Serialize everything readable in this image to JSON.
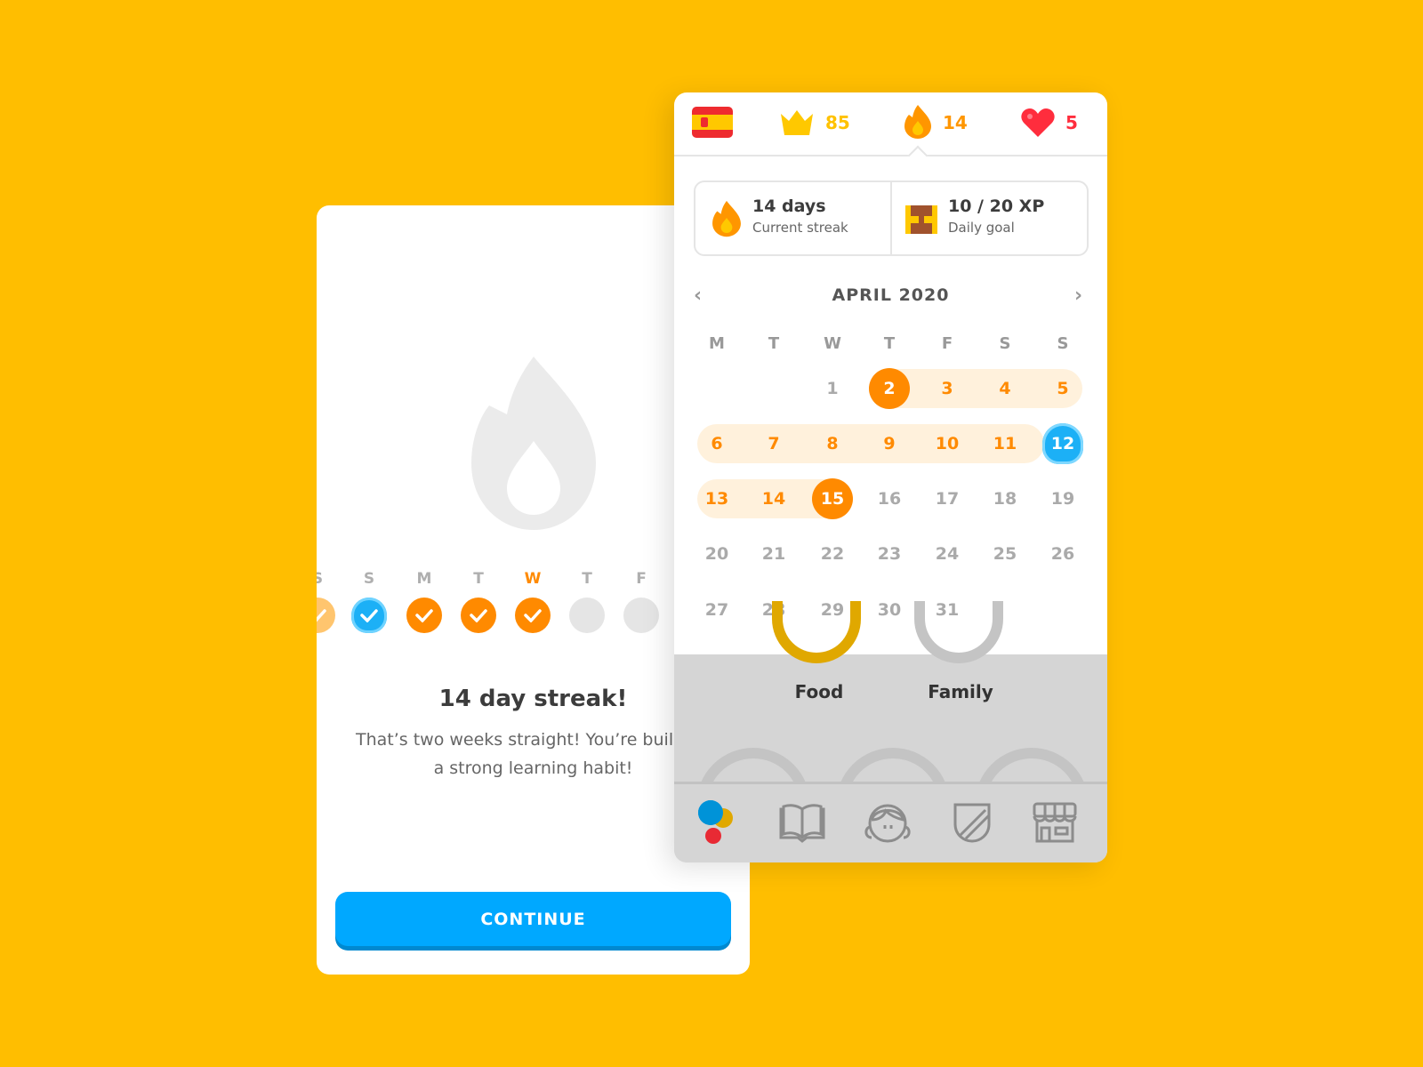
{
  "streak_card": {
    "week_days": [
      {
        "letter": "S",
        "state": "done-faded"
      },
      {
        "letter": "S",
        "state": "frozen"
      },
      {
        "letter": "M",
        "state": "done"
      },
      {
        "letter": "T",
        "state": "done"
      },
      {
        "letter": "W",
        "state": "done",
        "today": true
      },
      {
        "letter": "T",
        "state": "empty"
      },
      {
        "letter": "F",
        "state": "empty"
      }
    ],
    "title": "14 day streak!",
    "description_line1": "That’s two weeks straight! You’re building",
    "description_line2": "a strong learning habit!",
    "continue_label": "CONTINUE"
  },
  "header": {
    "flag": "spain-flag-icon",
    "crowns": "85",
    "streak": "14",
    "hearts": "5"
  },
  "stats": {
    "streak_value": "14 days",
    "streak_label": "Current streak",
    "goal_value": "10 / 20 XP",
    "goal_label": "Daily goal"
  },
  "calendar": {
    "month": "APRIL 2020",
    "weekdays": [
      "M",
      "T",
      "W",
      "T",
      "F",
      "S",
      "S"
    ],
    "days": [
      "1",
      "2",
      "3",
      "4",
      "5",
      "6",
      "7",
      "8",
      "9",
      "10",
      "11",
      "12",
      "13",
      "14",
      "15",
      "16",
      "17",
      "18",
      "19",
      "20",
      "21",
      "22",
      "23",
      "24",
      "25",
      "26",
      "27",
      "28",
      "29",
      "30",
      "31"
    ],
    "first_weekday_index": 2,
    "streak_days": [
      2,
      3,
      4,
      5,
      6,
      7,
      8,
      9,
      10,
      11,
      13,
      14,
      15
    ],
    "circled_days": [
      2,
      15
    ],
    "frozen_days": [
      12
    ]
  },
  "skills": [
    "Food",
    "Family"
  ],
  "nav": [
    "learn-icon",
    "stories-icon",
    "profile-icon",
    "league-shield-icon",
    "shop-icon"
  ],
  "colors": {
    "background": "#FFBE00",
    "orange": "#FF8A00",
    "blue": "#1CB0F6",
    "button": "#00A8FF",
    "red": "#FF2D3D"
  }
}
